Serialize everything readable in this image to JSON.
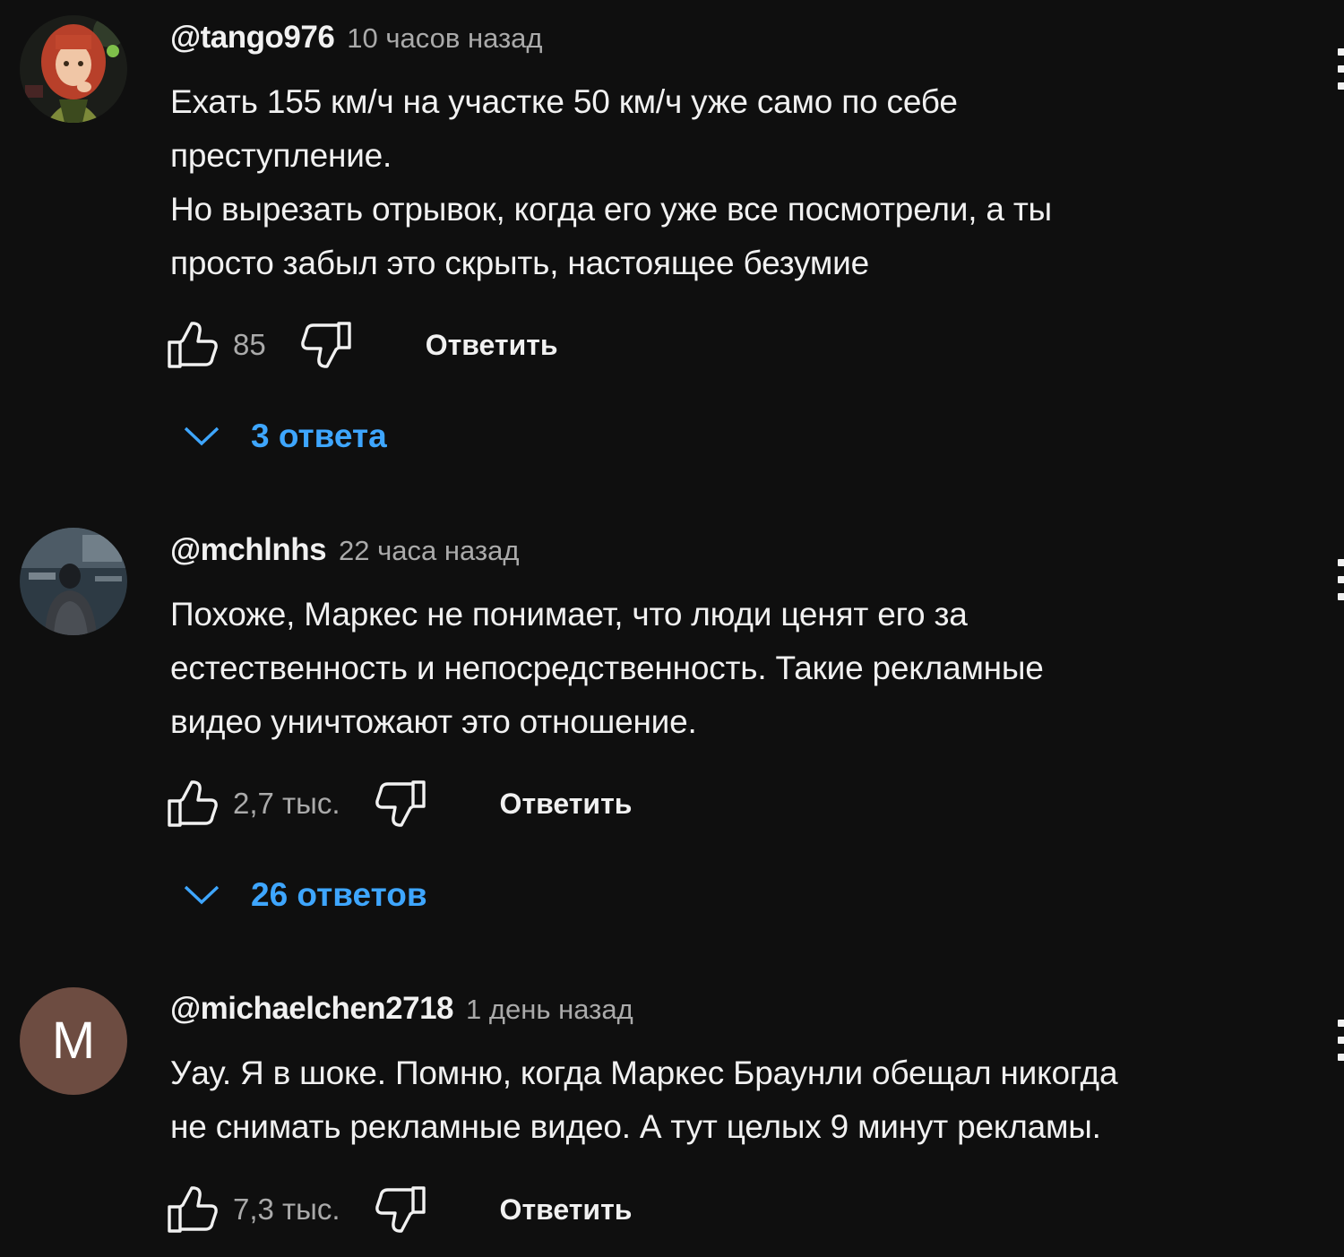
{
  "comments": [
    {
      "author": "@tango976",
      "time": "10 часов назад",
      "lines": [
        "Ехать 155 км/ч на участке 50 км/ч уже само по себе",
        "преступление.",
        "Но вырезать отрывок, когда его уже все посмотрели, а ты",
        "просто забыл это скрыть, настоящее безумие"
      ],
      "likes": "85",
      "reply_label": "Ответить",
      "replies_label": "3 ответа",
      "avatar": "anime-girl-avatar"
    },
    {
      "author": "@mchlnhs",
      "time": "22 часа назад",
      "lines": [
        "Похоже, Маркес не понимает, что люди ценят его за",
        "естественность и непосредственность. Такие рекламные",
        "видео уничтожают это отношение."
      ],
      "likes": "2,7 тыс.",
      "reply_label": "Ответить",
      "replies_label": "26 ответов",
      "avatar": "photo-person-avatar"
    },
    {
      "author": "@michaelchen2718",
      "time": "1 день назад",
      "lines": [
        "Уау. Я в шоке. Помню, когда Маркес Браунли обещал никогда",
        "не снимать рекламные видео. А тут целых 9 минут рекламы."
      ],
      "likes": "7,3 тыс.",
      "reply_label": "Ответить",
      "avatar_letter": "M",
      "avatar_color": "#6d4c41"
    }
  ],
  "colors": {
    "background": "#0f0f0f",
    "text": "#f1f1f1",
    "secondary": "#aaaaaa",
    "link": "#3ea6ff"
  },
  "icons": {
    "like": "thumbs-up-icon",
    "dislike": "thumbs-down-icon",
    "expand": "chevron-down-icon",
    "menu": "more-vert-icon"
  }
}
